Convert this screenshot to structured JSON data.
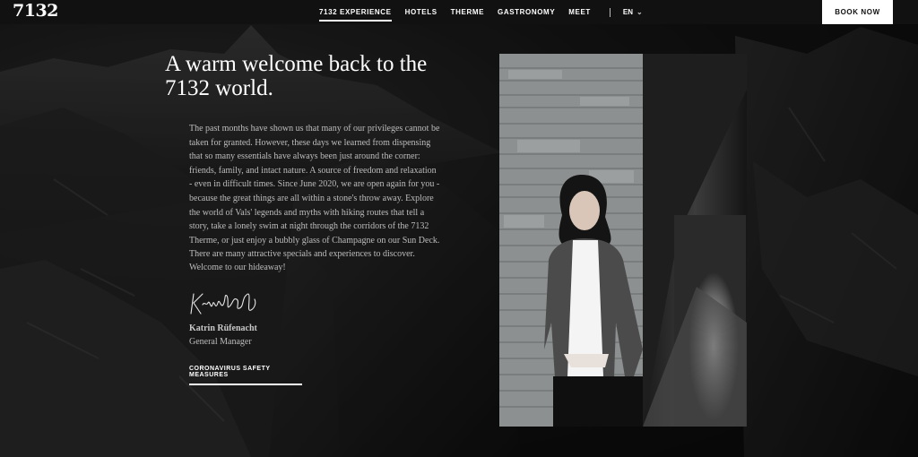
{
  "brand": {
    "logo": "7132"
  },
  "nav": {
    "items": [
      {
        "label": "7132 EXPERIENCE",
        "active": true
      },
      {
        "label": "HOTELS",
        "active": false
      },
      {
        "label": "THERME",
        "active": false
      },
      {
        "label": "GASTRONOMY",
        "active": false
      },
      {
        "label": "MEET",
        "active": false
      }
    ],
    "language": "EN",
    "book_label": "BOOK NOW"
  },
  "content": {
    "headline": "A warm welcome back to the 7132 world.",
    "body": "The past months have shown us that many of our privileges cannot be taken for granted. However, these days we learned from dispensing that so many essentials have always been just around the corner: friends, family, and intact nature. A source of freedom and relaxation - even in difficult times. Since June 2020, we are open again for you - because the great things are all within a stone's throw away. Explore the world of Vals' legends and myths with hiking routes that tell a story, take a lonely swim at night through the corridors of the 7132 Therme, or just enjoy a bubbly glass of Champagne on our Sun Deck. There are many attractive specials and experiences to discover.",
    "welcome": "Welcome to our hideaway!",
    "signer_name": "Katrin Rüfenacht",
    "signer_role": "General Manager",
    "covid_link": "CORONAVIRUS SAFETY MEASURES"
  },
  "colors": {
    "background": "#0c0c0c",
    "topbar": "#111111",
    "text_muted": "#bdbdbd",
    "button_bg": "#ffffff"
  }
}
